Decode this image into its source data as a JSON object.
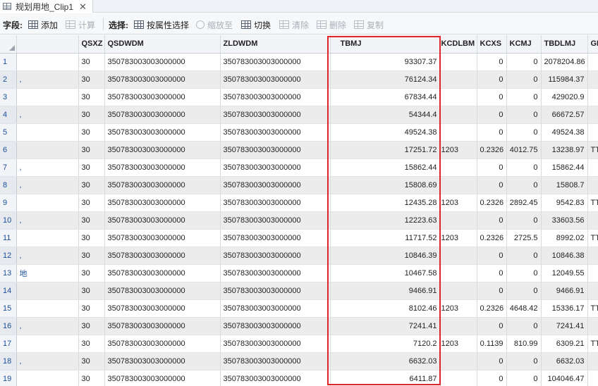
{
  "tab": {
    "title": "规划用地_Clip1",
    "close": "✕"
  },
  "toolbar": {
    "field_label": "字段:",
    "add": "添加",
    "calculate": "计算",
    "select_label": "选择:",
    "select_by_attr": "按属性选择",
    "zoom_to": "缩放至",
    "switch": "切换",
    "clear": "清除",
    "delete": "删除",
    "copy": "复制"
  },
  "columns": [
    "QSXZ",
    "QSDWDM",
    "ZLDWDM",
    "TBMJ",
    "KCDLBM",
    "KCXS",
    "KCMJ",
    "TBDLMJ",
    "GD"
  ],
  "rows": [
    {
      "n": "1",
      "left": "",
      "QSXZ": "30",
      "QSDWDM": "350783003003000000",
      "ZLDWDM": "350783003003000000",
      "TBMJ": "93307.37",
      "KCDLBM": "",
      "KCXS": "0",
      "KCMJ": "0",
      "TBDLMJ": "2078204.86",
      "GD": ""
    },
    {
      "n": "2",
      "left": ",",
      "QSXZ": "30",
      "QSDWDM": "350783003003000000",
      "ZLDWDM": "350783003003000000",
      "TBMJ": "76124.34",
      "KCDLBM": "",
      "KCXS": "0",
      "KCMJ": "0",
      "TBDLMJ": "115984.37",
      "GD": ""
    },
    {
      "n": "3",
      "left": "",
      "QSXZ": "30",
      "QSDWDM": "350783003003000000",
      "ZLDWDM": "350783003003000000",
      "TBMJ": "67834.44",
      "KCDLBM": "",
      "KCXS": "0",
      "KCMJ": "0",
      "TBDLMJ": "429020.9",
      "GD": ""
    },
    {
      "n": "4",
      "left": ",",
      "QSXZ": "30",
      "QSDWDM": "350783003003000000",
      "ZLDWDM": "350783003003000000",
      "TBMJ": "54344.4",
      "KCDLBM": "",
      "KCXS": "0",
      "KCMJ": "0",
      "TBDLMJ": "66672.57",
      "GD": ""
    },
    {
      "n": "5",
      "left": "",
      "QSXZ": "30",
      "QSDWDM": "350783003003000000",
      "ZLDWDM": "350783003003000000",
      "TBMJ": "49524.38",
      "KCDLBM": "",
      "KCXS": "0",
      "KCMJ": "0",
      "TBDLMJ": "49524.38",
      "GD": ""
    },
    {
      "n": "6",
      "left": "",
      "QSXZ": "30",
      "QSDWDM": "350783003003000000",
      "ZLDWDM": "350783003003000000",
      "TBMJ": "17251.72",
      "KCDLBM": "1203",
      "KCXS": "0.2326",
      "KCMJ": "4012.75",
      "TBDLMJ": "13238.97",
      "GD": "TT"
    },
    {
      "n": "7",
      "left": ",",
      "QSXZ": "30",
      "QSDWDM": "350783003003000000",
      "ZLDWDM": "350783003003000000",
      "TBMJ": "15862.44",
      "KCDLBM": "",
      "KCXS": "0",
      "KCMJ": "0",
      "TBDLMJ": "15862.44",
      "GD": ""
    },
    {
      "n": "8",
      "left": ",",
      "QSXZ": "30",
      "QSDWDM": "350783003003000000",
      "ZLDWDM": "350783003003000000",
      "TBMJ": "15808.69",
      "KCDLBM": "",
      "KCXS": "0",
      "KCMJ": "0",
      "TBDLMJ": "15808.7",
      "GD": ""
    },
    {
      "n": "9",
      "left": "",
      "QSXZ": "30",
      "QSDWDM": "350783003003000000",
      "ZLDWDM": "350783003003000000",
      "TBMJ": "12435.28",
      "KCDLBM": "1203",
      "KCXS": "0.2326",
      "KCMJ": "2892.45",
      "TBDLMJ": "9542.83",
      "GD": "TT"
    },
    {
      "n": "10",
      "left": ",",
      "QSXZ": "30",
      "QSDWDM": "350783003003000000",
      "ZLDWDM": "350783003003000000",
      "TBMJ": "12223.63",
      "KCDLBM": "",
      "KCXS": "0",
      "KCMJ": "0",
      "TBDLMJ": "33603.56",
      "GD": ""
    },
    {
      "n": "11",
      "left": "",
      "QSXZ": "30",
      "QSDWDM": "350783003003000000",
      "ZLDWDM": "350783003003000000",
      "TBMJ": "11717.52",
      "KCDLBM": "1203",
      "KCXS": "0.2326",
      "KCMJ": "2725.5",
      "TBDLMJ": "8992.02",
      "GD": "TT"
    },
    {
      "n": "12",
      "left": ",",
      "QSXZ": "30",
      "QSDWDM": "350783003003000000",
      "ZLDWDM": "350783003003000000",
      "TBMJ": "10846.39",
      "KCDLBM": "",
      "KCXS": "0",
      "KCMJ": "0",
      "TBDLMJ": "10846.38",
      "GD": ""
    },
    {
      "n": "13",
      "left": "地",
      "QSXZ": "30",
      "QSDWDM": "350783003003000000",
      "ZLDWDM": "350783003003000000",
      "TBMJ": "10467.58",
      "KCDLBM": "",
      "KCXS": "0",
      "KCMJ": "0",
      "TBDLMJ": "12049.55",
      "GD": ""
    },
    {
      "n": "14",
      "left": "",
      "QSXZ": "30",
      "QSDWDM": "350783003003000000",
      "ZLDWDM": "350783003003000000",
      "TBMJ": "9466.91",
      "KCDLBM": "",
      "KCXS": "0",
      "KCMJ": "0",
      "TBDLMJ": "9466.91",
      "GD": ""
    },
    {
      "n": "15",
      "left": "",
      "QSXZ": "30",
      "QSDWDM": "350783003003000000",
      "ZLDWDM": "350783003003000000",
      "TBMJ": "8102.46",
      "KCDLBM": "1203",
      "KCXS": "0.2326",
      "KCMJ": "4648.42",
      "TBDLMJ": "15336.17",
      "GD": "TT"
    },
    {
      "n": "16",
      "left": ",",
      "QSXZ": "30",
      "QSDWDM": "350783003003000000",
      "ZLDWDM": "350783003003000000",
      "TBMJ": "7241.41",
      "KCDLBM": "",
      "KCXS": "0",
      "KCMJ": "0",
      "TBDLMJ": "7241.41",
      "GD": ""
    },
    {
      "n": "17",
      "left": "",
      "QSXZ": "30",
      "QSDWDM": "350783003003000000",
      "ZLDWDM": "350783003003000000",
      "TBMJ": "7120.2",
      "KCDLBM": "1203",
      "KCXS": "0.1139",
      "KCMJ": "810.99",
      "TBDLMJ": "6309.21",
      "GD": "TT"
    },
    {
      "n": "18",
      "left": ",",
      "QSXZ": "30",
      "QSDWDM": "350783003003000000",
      "ZLDWDM": "350783003003000000",
      "TBMJ": "6632.03",
      "KCDLBM": "",
      "KCXS": "0",
      "KCMJ": "0",
      "TBDLMJ": "6632.03",
      "GD": ""
    },
    {
      "n": "19",
      "left": "",
      "QSXZ": "30",
      "QSDWDM": "350783003003000000",
      "ZLDWDM": "350783003003000000",
      "TBMJ": "6411.87",
      "KCDLBM": "",
      "KCXS": "0",
      "KCMJ": "0",
      "TBDLMJ": "104046.47",
      "GD": ""
    }
  ],
  "colors": {
    "highlight": "#e0242a",
    "row_alt": "#ececec",
    "row_number": "#1a4f9a"
  }
}
